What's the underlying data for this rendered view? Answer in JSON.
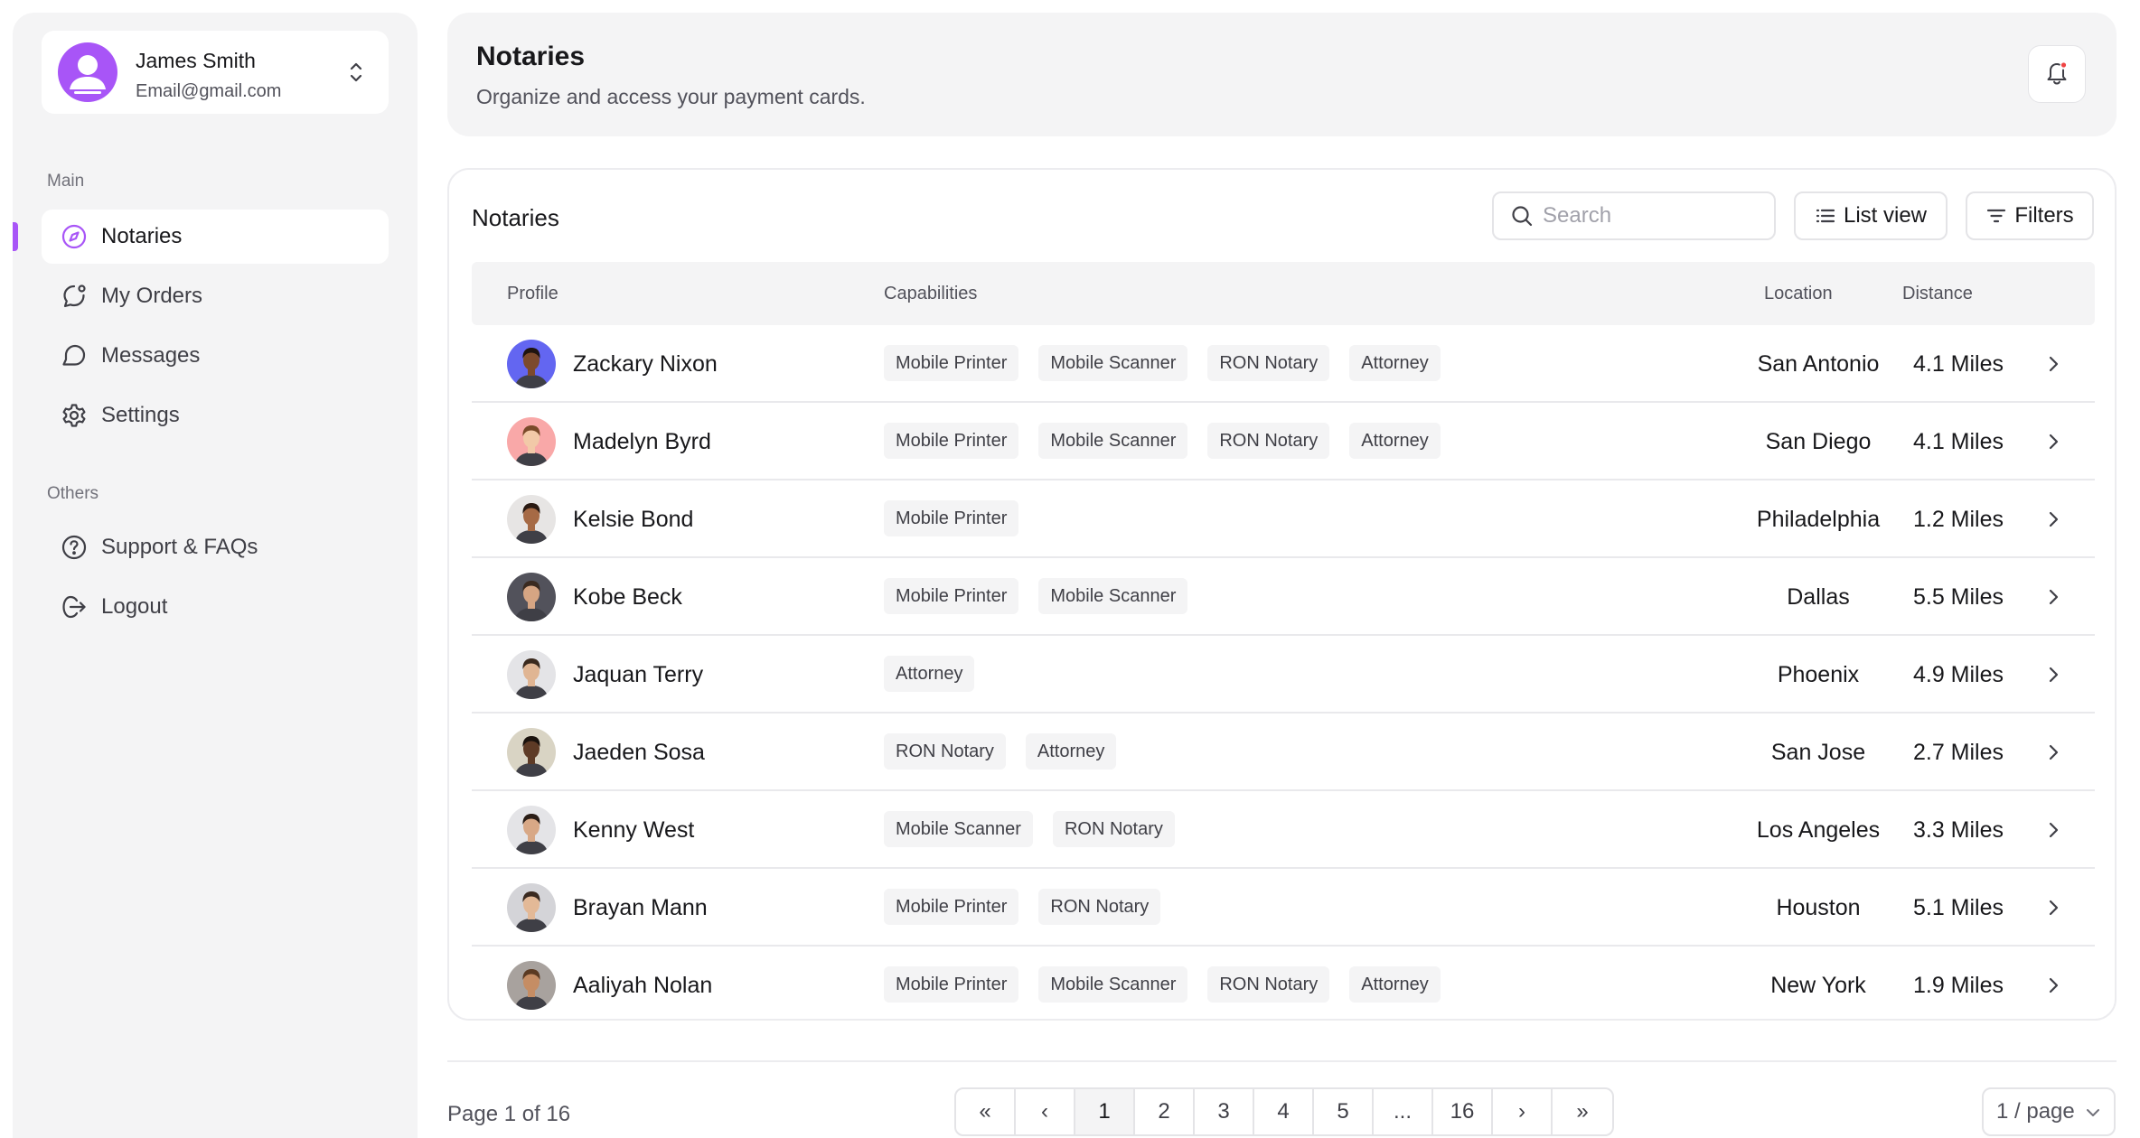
{
  "user": {
    "name": "James Smith",
    "email": "Email@gmail.com",
    "avatar_color": "#a855f7"
  },
  "sidebar": {
    "main_label": "Main",
    "others_label": "Others",
    "main_items": [
      {
        "label": "Notaries",
        "icon": "compass-icon",
        "active": true
      },
      {
        "label": "My Orders",
        "icon": "chat-bubble-icon",
        "active": false
      },
      {
        "label": "Messages",
        "icon": "message-icon",
        "active": false
      },
      {
        "label": "Settings",
        "icon": "gear-icon",
        "active": false
      }
    ],
    "other_items": [
      {
        "label": "Support & FAQs",
        "icon": "help-circle-icon"
      },
      {
        "label": "Logout",
        "icon": "logout-icon"
      }
    ],
    "accent": "#a855f7"
  },
  "header": {
    "title": "Notaries",
    "subtitle": "Organize and access your payment cards."
  },
  "table": {
    "title": "Notaries",
    "search_placeholder": "Search",
    "list_view_label": "List view",
    "filters_label": "Filters",
    "columns": {
      "profile": "Profile",
      "capabilities": "Capabilities",
      "location": "Location",
      "distance": "Distance"
    },
    "rows": [
      {
        "name": "Zackary Nixon",
        "capabilities": [
          "Mobile Printer",
          "Mobile Scanner",
          "RON Notary",
          "Attorney"
        ],
        "location": "San Antonio",
        "distance": "4.1 Miles",
        "avatar_bg": "#6366f1",
        "skin": "#7c4a2d",
        "hair": "#1f1410"
      },
      {
        "name": "Madelyn Byrd",
        "capabilities": [
          "Mobile Printer",
          "Mobile Scanner",
          "RON Notary",
          "Attorney"
        ],
        "location": "San Diego",
        "distance": "4.1 Miles",
        "avatar_bg": "#f9a8a8",
        "skin": "#f2c9a8",
        "hair": "#7a4a2a"
      },
      {
        "name": "Kelsie Bond",
        "capabilities": [
          "Mobile Printer"
        ],
        "location": "Philadelphia",
        "distance": "1.2 Miles",
        "avatar_bg": "#e7e5e4",
        "skin": "#a66a45",
        "hair": "#2a1a12"
      },
      {
        "name": "Kobe Beck",
        "capabilities": [
          "Mobile Printer",
          "Mobile Scanner"
        ],
        "location": "Dallas",
        "distance": "5.5 Miles",
        "avatar_bg": "#52525b",
        "skin": "#d6a583",
        "hair": "#3a2a20"
      },
      {
        "name": "Jaquan Terry",
        "capabilities": [
          "Attorney"
        ],
        "location": "Phoenix",
        "distance": "4.9 Miles",
        "avatar_bg": "#e4e4e7",
        "skin": "#e0b593",
        "hair": "#3b2a1e"
      },
      {
        "name": "Jaeden Sosa",
        "capabilities": [
          "RON Notary",
          "Attorney"
        ],
        "location": "San Jose",
        "distance": "2.7 Miles",
        "avatar_bg": "#d9d4c4",
        "skin": "#5e3b26",
        "hair": "#1a120d"
      },
      {
        "name": "Kenny West",
        "capabilities": [
          "Mobile Scanner",
          "RON Notary"
        ],
        "location": "Los Angeles",
        "distance": "3.3 Miles",
        "avatar_bg": "#e4e4e7",
        "skin": "#d8a886",
        "hair": "#2a1d16"
      },
      {
        "name": "Brayan Mann",
        "capabilities": [
          "Mobile Printer",
          "RON Notary"
        ],
        "location": "Houston",
        "distance": "5.1 Miles",
        "avatar_bg": "#d4d4d8",
        "skin": "#e3b997",
        "hair": "#3a2a20"
      },
      {
        "name": "Aaliyah Nolan",
        "capabilities": [
          "Mobile Printer",
          "Mobile Scanner",
          "RON Notary",
          "Attorney"
        ],
        "location": "New York",
        "distance": "1.9 Miles",
        "avatar_bg": "#a8a29e",
        "skin": "#c58d64",
        "hair": "#5a3a22"
      }
    ]
  },
  "pagination": {
    "info": "Page 1 of 16",
    "first": "«",
    "prev": "‹",
    "pages": [
      "1",
      "2",
      "3",
      "4",
      "5",
      "...",
      "16"
    ],
    "current": "1",
    "next": "›",
    "last": "»",
    "per_page": "1 / page"
  }
}
